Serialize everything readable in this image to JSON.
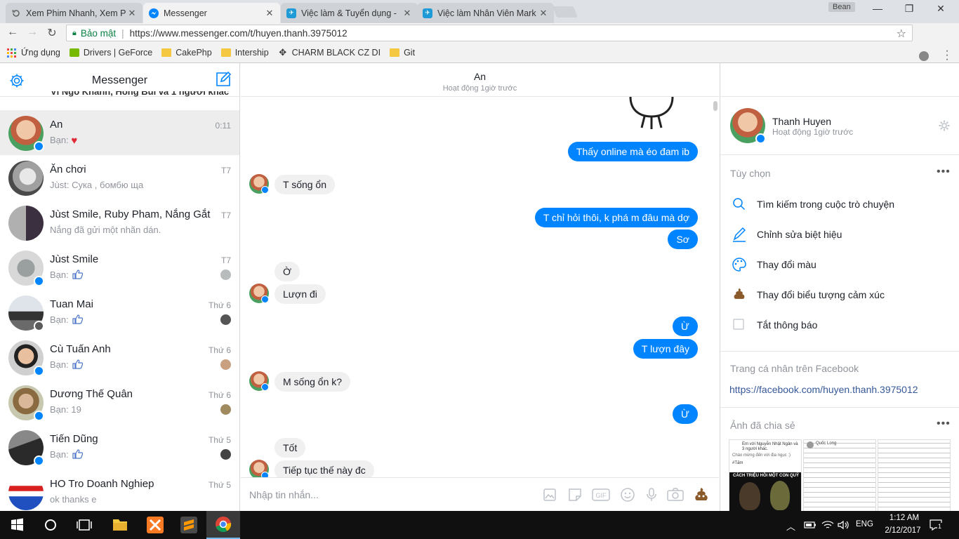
{
  "browser": {
    "tabs": [
      {
        "title": "Xem Phim Nhanh, Xem P",
        "icon": "refresh-icon"
      },
      {
        "title": "Messenger",
        "icon": "messenger-icon"
      },
      {
        "title": "Việc làm & Tuyển dụng -",
        "icon": "job-site-icon"
      },
      {
        "title": "Việc làm Nhân Viên Mark",
        "icon": "job-site-icon"
      }
    ],
    "active_tab": 1,
    "profile_name": "Bean",
    "security_label": "Bảo mật",
    "url": "https://www.messenger.com/t/huyen.thanh.3975012",
    "bookmarks": [
      {
        "label": "Ứng dụng",
        "icon": "apps-grid-icon"
      },
      {
        "label": "Drivers | GeForce",
        "icon": "nvidia-icon"
      },
      {
        "label": "CakePhp",
        "icon": "folder-icon"
      },
      {
        "label": "Intership",
        "icon": "folder-icon"
      },
      {
        "label": "CHARM BLACK CZ DI",
        "icon": "move-icon"
      },
      {
        "label": "Git",
        "icon": "folder-icon"
      }
    ]
  },
  "sidebar": {
    "title": "Messenger",
    "clipped_text": "Vĩ Ngô Khánh, Hồng Bùi và 1 người khác",
    "conversations": [
      {
        "name": "An",
        "snippet": "Bạn:",
        "snippet_emoji": "heart",
        "time": "0:11",
        "selected": true
      },
      {
        "name": "Ăn chơi",
        "snippet": "Jùst: Сука , бомбю ща",
        "time": "T7"
      },
      {
        "name": "Jùst Smile, Ruby Pham, Nắng Gắt",
        "snippet": "Nắng đã gửi một nhãn dán.",
        "time": "T7"
      },
      {
        "name": "Jùst Smile",
        "snippet": "Bạn:",
        "snippet_emoji": "like",
        "time": "T7"
      },
      {
        "name": "Tuan Mai",
        "snippet": "Bạn:",
        "snippet_emoji": "like",
        "time": "Thứ 6"
      },
      {
        "name": "Cù Tuấn Anh",
        "snippet": "Bạn:",
        "snippet_emoji": "like",
        "time": "Thứ 6"
      },
      {
        "name": "Dương Thế Quân",
        "snippet": "Bạn: 19",
        "time": "Thứ 6"
      },
      {
        "name": "Tiến Dũng",
        "snippet": "Bạn:",
        "snippet_emoji": "like",
        "time": "Thứ 5"
      },
      {
        "name": "HO Tro Doanh Nghiep",
        "snippet": "ok thanks e",
        "time": "Thứ 5"
      }
    ]
  },
  "chat": {
    "contact_name": "An",
    "status": "Hoạt động 1giờ trước",
    "messages": [
      {
        "from": "me",
        "text": "Thấy online mà éo đam ib"
      },
      {
        "from": "them",
        "text": "T sống ổn"
      },
      {
        "from": "me",
        "text": "T chỉ hỏi thôi, k phá m đâu mà dợ"
      },
      {
        "from": "me",
        "text": "Sơ"
      },
      {
        "from": "them",
        "text": "Ờ"
      },
      {
        "from": "them",
        "text": "Lượn đi"
      },
      {
        "from": "me",
        "text": "Ừ"
      },
      {
        "from": "me",
        "text": "T lượn đây"
      },
      {
        "from": "them",
        "text": "M sống ổn k?"
      },
      {
        "from": "me",
        "text": "Ừ"
      },
      {
        "from": "them",
        "text": "Tốt"
      },
      {
        "from": "them",
        "text": "Tiếp tục thế này đc"
      }
    ],
    "composer_placeholder": "Nhập tin nhắn...",
    "accent": "#0084ff"
  },
  "details": {
    "name": "Thanh Huyen",
    "status": "Hoạt động 1giờ trước",
    "options_label": "Tùy chọn",
    "options": [
      {
        "label": "Tìm kiếm trong cuộc trò chuyện",
        "icon": "search-icon"
      },
      {
        "label": "Chỉnh sửa biệt hiệu",
        "icon": "pencil-icon"
      },
      {
        "label": "Thay đổi màu",
        "icon": "palette-icon"
      },
      {
        "label": "Thay đổi biểu tượng cảm xúc",
        "icon": "emoji-icon"
      },
      {
        "label": "Tắt thông báo",
        "icon": "checkbox-icon"
      }
    ],
    "profile_label": "Trang cá nhân trên Facebook",
    "profile_link": "https://facebook.com/huyen.thanh.3975012",
    "shared_photos_label": "Ảnh đã chia sẻ",
    "photo_caption": "CÁCH TRIỆU HỒI MỘT CON QUỶ",
    "photo_text_1": "Em với Nguyễn Nhật Ngân và 3 người khác.",
    "photo_text_2": "Chào mừng đến với địa ngục :)",
    "photo_text_3": "#Tấm",
    "photo_text_4": "Quốc Long"
  },
  "taskbar": {
    "time": "1:12 AM",
    "date": "2/12/2017",
    "language": "ENG",
    "notification_count": "1"
  }
}
